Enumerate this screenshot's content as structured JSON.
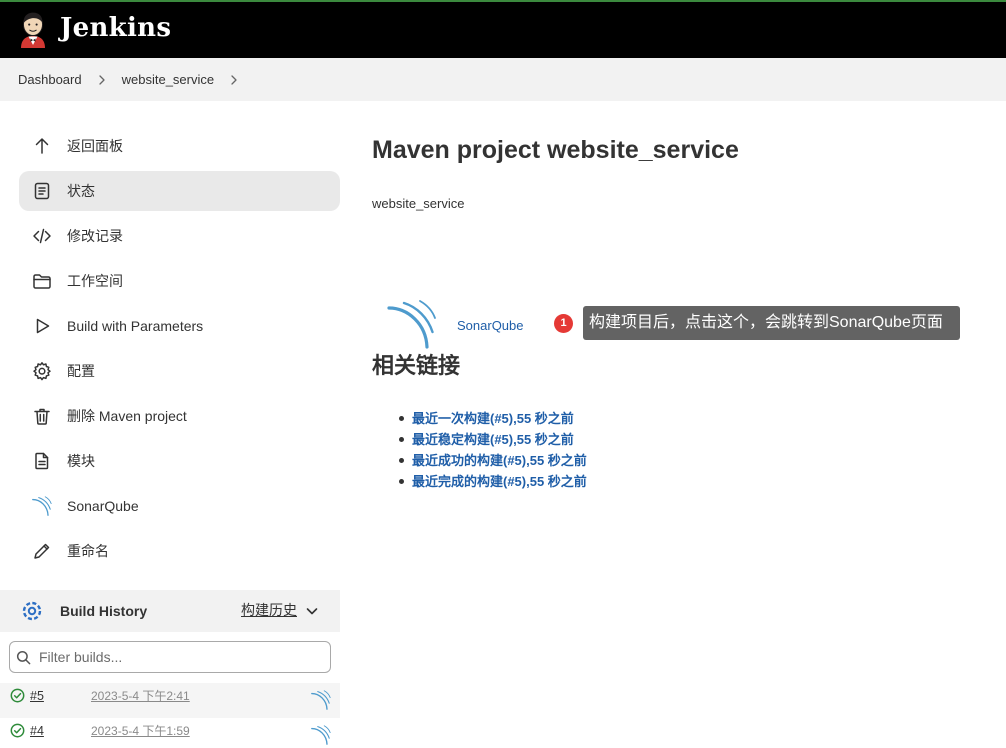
{
  "app": {
    "title": "Jenkins",
    "logo_icon": "jenkins-butler-icon"
  },
  "colors": {
    "header_bg": "#000000",
    "header_accent": "#3b8a3e",
    "link": "#1f5ea8",
    "badge": "#e53935",
    "tooltip_bg": "#636363",
    "success": "#2e8b3a",
    "sonar": "#4e9bcd",
    "active_item_bg": "#e9e9e9"
  },
  "breadcrumb": {
    "items": [
      {
        "label": "Dashboard"
      },
      {
        "label": "website_service"
      }
    ],
    "separator_icon": "chevron-right-icon"
  },
  "sidebar": {
    "items": [
      {
        "label": "返回面板",
        "icon": "arrow-up-icon"
      },
      {
        "label": "状态",
        "icon": "document-icon",
        "active": true
      },
      {
        "label": "修改记录",
        "icon": "code-icon"
      },
      {
        "label": "工作空间",
        "icon": "folder-icon"
      },
      {
        "label": "Build with Parameters",
        "icon": "play-icon"
      },
      {
        "label": "配置",
        "icon": "gear-icon"
      },
      {
        "label": "删除 Maven project",
        "icon": "trash-icon"
      },
      {
        "label": "模块",
        "icon": "module-icon"
      },
      {
        "label": "SonarQube",
        "icon": "sonarqube-icon"
      },
      {
        "label": "重命名",
        "icon": "pencil-icon"
      }
    ]
  },
  "build_history": {
    "icon": "build-history-icon",
    "title": "Build History",
    "trend_label": "构建历史",
    "filter_placeholder": "Filter builds...",
    "builds": [
      {
        "number": "#5",
        "time": "2023-5-4 下午2:41",
        "status_icon": "success-check-icon",
        "report_icon": "sonarqube-icon"
      },
      {
        "number": "#4",
        "time": "2023-5-4 下午1:59",
        "status_icon": "success-check-icon",
        "report_icon": "sonarqube-icon"
      }
    ]
  },
  "main": {
    "title": "Maven project website_service",
    "description": "website_service",
    "sonar_link": "SonarQube",
    "callout": {
      "badge": "1",
      "text": "构建项目后，点击这个，会跳转到SonarQube页面"
    },
    "related_heading": "相关链接",
    "related_links": [
      "最近一次构建(#5),55 秒之前",
      "最近稳定构建(#5),55 秒之前",
      "最近成功的构建(#5),55 秒之前",
      "最近完成的构建(#5),55 秒之前"
    ]
  }
}
